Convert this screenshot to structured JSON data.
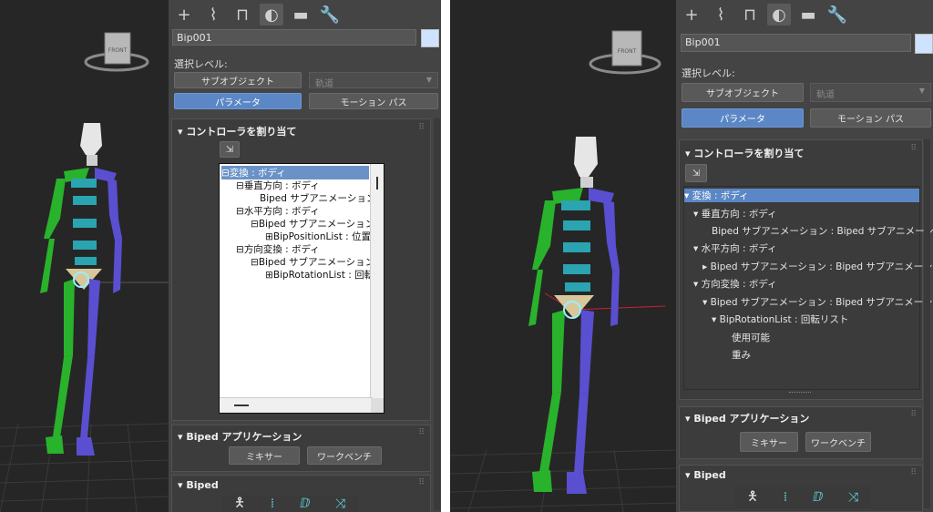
{
  "left": {
    "object_name": "Bip001",
    "selection_level_label": "選択レベル:",
    "sub_object_button": "サブオブジェクト",
    "trajectory_dropdown": "軌道",
    "parameters_button": "パラメータ",
    "motion_path_button": "モーション パス",
    "assign_controller_title": "コントローラを割り当て",
    "tree": [
      {
        "text": "変換 : ボディ",
        "prefix": "⊟"
      },
      {
        "text": "垂直方向 : ボディ",
        "prefix": "⊟"
      },
      {
        "text": "Biped サブアニメーション :",
        "prefix": ""
      },
      {
        "text": "水平方向 : ボディ",
        "prefix": "⊟"
      },
      {
        "text": "Biped サブアニメーション :",
        "prefix": "⊟"
      },
      {
        "text": "BipPositionList : 位置!",
        "prefix": "⊞"
      },
      {
        "text": "方向変換 : ボディ",
        "prefix": "⊟"
      },
      {
        "text": "Biped サブアニメーション :",
        "prefix": "⊟"
      },
      {
        "text": "BipRotationList : 回転",
        "prefix": "⊞"
      }
    ],
    "biped_app_title": "Biped アプリケーション",
    "mixer_button": "ミキサー",
    "workbench_button": "ワークベンチ",
    "biped_title": "Biped"
  },
  "right": {
    "object_name": "Bip001",
    "selection_level_label": "選択レベル:",
    "sub_object_button": "サブオブジェクト",
    "trajectory_dropdown": "軌道",
    "parameters_button": "パラメータ",
    "motion_path_button": "モーション パス",
    "assign_controller_title": "コントローラを割り当て",
    "tree": [
      {
        "text": "変換 : ボディ",
        "prefix": "▾"
      },
      {
        "text": "垂直方向 : ボディ",
        "prefix": "▾"
      },
      {
        "text": "Biped サブアニメーション : Biped サブアニメーション",
        "prefix": ""
      },
      {
        "text": "水平方向 : ボディ",
        "prefix": "▾"
      },
      {
        "text": "Biped サブアニメーション : Biped サブアニメーション",
        "prefix": "▸"
      },
      {
        "text": "方向変換 : ボディ",
        "prefix": "▾"
      },
      {
        "text": "Biped サブアニメーション : Biped サブアニメーション",
        "prefix": "▾"
      },
      {
        "text": "BipRotationList : 回転リスト",
        "prefix": "▾"
      },
      {
        "text": "使用可能",
        "prefix": ""
      },
      {
        "text": "重み",
        "prefix": ""
      }
    ],
    "biped_app_title": "Biped アプリケーション",
    "mixer_button": "ミキサー",
    "workbench_button": "ワークベンチ",
    "biped_title": "Biped"
  },
  "viewcube_label": "FRONT",
  "icons": [
    "plus-icon",
    "curve-icon",
    "hierarchy-icon",
    "motion-icon",
    "display-icon",
    "wrench-icon"
  ],
  "colors": {
    "panel": "#444444",
    "viewport": "#262626",
    "selection": "#5b87c6"
  }
}
